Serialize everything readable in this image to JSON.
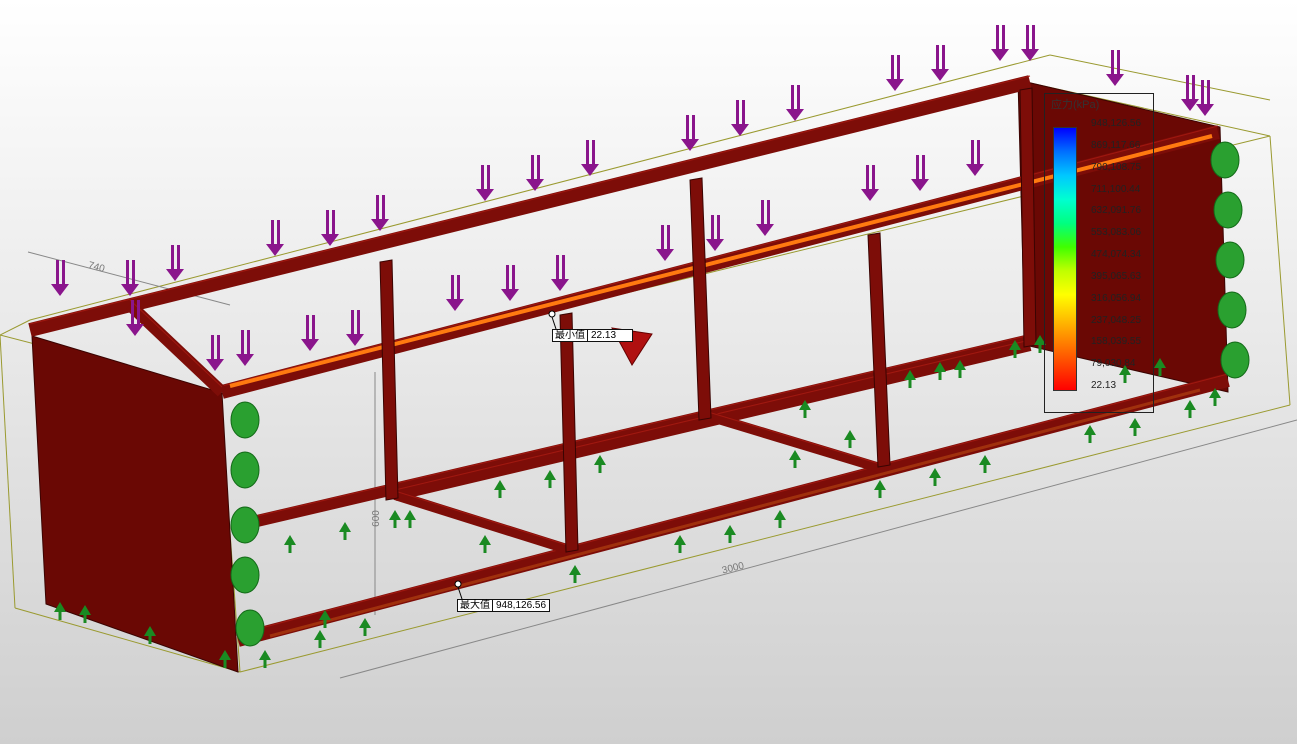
{
  "legend": {
    "title": "应力(kPa)",
    "labels": [
      "948,126.56",
      "869,117.66",
      "790,108.75",
      "711,100.44",
      "632,091.76",
      "553,083.06",
      "474,074.34",
      "395,065.63",
      "316,056.94",
      "237,048.25",
      "158,039.55",
      "79,030.84",
      "22.13"
    ],
    "gradient": [
      "#0000ff",
      "#0070ff",
      "#00c8ff",
      "#00ffd0",
      "#00ff80",
      "#40ff00",
      "#c0ff00",
      "#ffff00",
      "#ffc000",
      "#ff8000",
      "#ff4000",
      "#ff0000"
    ]
  },
  "callouts": {
    "min": {
      "label": "最小值",
      "value": "22.13"
    },
    "max": {
      "label": "最大值",
      "value": "948,126.56"
    }
  },
  "dimensions": {
    "depth": "740",
    "height": "600",
    "length": "3000"
  },
  "colors": {
    "frame": "#7d0d08",
    "frame_dark": "#5a0804",
    "panel": "#6a0804",
    "hot_beam": "#ff7a10",
    "load_arrow": "#8a158c",
    "fixture": "#1a8a22",
    "bbox": "#9a9a30"
  },
  "icons": {
    "load": "downward-arrow-icon",
    "fixture": "upward-arrow-icon"
  }
}
